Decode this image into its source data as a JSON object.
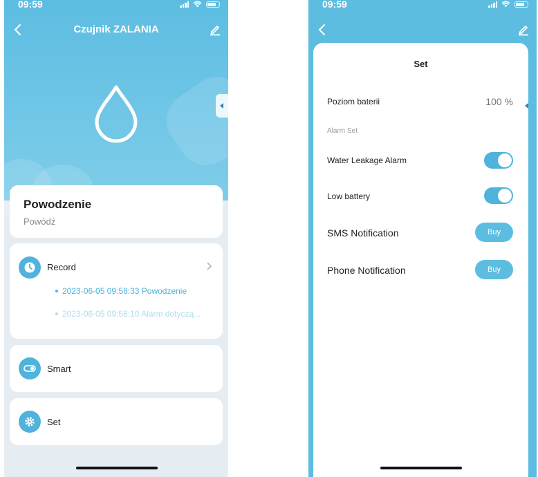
{
  "left_screen": {
    "status_bar": {
      "time": "09:59"
    },
    "header": {
      "title": "Czujnik ZALANIA",
      "back_icon": "chevron-left-icon",
      "edit_icon": "pencil-icon"
    },
    "hero": {
      "icon": "water-drop-icon"
    },
    "status_card": {
      "title": "Powodzenie",
      "subtitle": "Powódź"
    },
    "record_card": {
      "label": "Record",
      "icon": "clock-icon",
      "items": [
        "2023-06-05 09:58:33 Powodzenie",
        "2023-06-05 09:58:10 Alarm dotyczą..."
      ]
    },
    "smart_card": {
      "label": "Smart",
      "icon": "toggle-icon"
    },
    "set_card": {
      "label": "Set",
      "icon": "gear-icon"
    }
  },
  "right_screen": {
    "status_bar": {
      "time": "09:59"
    },
    "sheet": {
      "title": "Set",
      "battery": {
        "label": "Poziom baterii",
        "value": "100 %"
      },
      "section_label": "Alarm Set",
      "toggles": [
        {
          "label": "Water Leakage Alarm",
          "on": true
        },
        {
          "label": "Low battery",
          "on": true
        }
      ],
      "notifications": [
        {
          "label": "SMS Notification",
          "button": "Buy"
        },
        {
          "label": "Phone Notification",
          "button": "Buy"
        }
      ]
    }
  },
  "colors": {
    "accent": "#4fb3dc",
    "hero": "#5cbde2",
    "page_bg": "#e6edf2"
  }
}
